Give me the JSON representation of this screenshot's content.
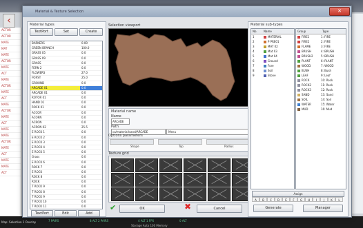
{
  "background": {
    "left_rows": [
      "ACTOR",
      "ACTOR",
      "MATE",
      "MAT",
      "MATE",
      "ACTOR",
      "MATE",
      "ACT",
      "MATE",
      "ACTOR",
      "MATE",
      "ACT",
      "MATE",
      "ACTOR",
      "MATE",
      "ACT",
      "MATE",
      "MATE",
      "ACTOR",
      "MATE",
      "ACT",
      "MATE",
      "MATE",
      "ACT"
    ],
    "status_text": "Map: Selection 1 Overlay",
    "stats": [
      "7 PAIRS",
      "8 ALT 2 PAIRS",
      "4 ALT 1 FPS",
      "0 ALT"
    ],
    "bottom_hint": "Storage  Auto  100  Memory"
  },
  "dialog": {
    "title": "Material & Texture Selection",
    "close_label": "✕"
  },
  "left_panel": {
    "header": "Material types",
    "buttons": [
      "TextPort",
      "Set",
      "Create"
    ],
    "materials": [
      {
        "name": "BARKERS",
        "value": "0.00"
      },
      {
        "name": "GREEN BRANCH",
        "value": "100.0"
      },
      {
        "name": "GRASS 05",
        "value": "0.0"
      },
      {
        "name": "GRASS 09",
        "value": "0.0"
      },
      {
        "name": "GRASS",
        "value": "0.0"
      },
      {
        "name": "FERN 2",
        "value": "0.0"
      },
      {
        "name": "FLOWERS",
        "value": "27.0"
      },
      {
        "name": "FORST",
        "value": "25.0"
      },
      {
        "name": "GROUND",
        "value": "0.0"
      },
      {
        "name": "ARCADE 01",
        "value": "0.0"
      },
      {
        "name": "ARCADE 01",
        "value": "0.0"
      },
      {
        "name": "ROTOR 01",
        "value": "0.0"
      },
      {
        "name": "HAND 01",
        "value": "0.0"
      },
      {
        "name": "ROCK 01",
        "value": "0.0"
      },
      {
        "name": "ACCOR",
        "value": "0.0"
      },
      {
        "name": "ACORN",
        "value": "0.0"
      },
      {
        "name": "ACRON",
        "value": "0.0"
      },
      {
        "name": "ACRON 02",
        "value": "25.5"
      },
      {
        "name": "E ROCK 1",
        "value": "0.0"
      },
      {
        "name": "E ROCK 2",
        "value": "0.0"
      },
      {
        "name": "E ROCK 3",
        "value": "0.0"
      },
      {
        "name": "E ROCK 4",
        "value": "0.0"
      },
      {
        "name": "E ROCK 5",
        "value": "0.0"
      },
      {
        "name": "Grass",
        "value": "0.0"
      },
      {
        "name": "E ROCK 6",
        "value": "0.0"
      },
      {
        "name": "ROCK 7",
        "value": "0.0"
      },
      {
        "name": "E ROCK",
        "value": "0.0"
      },
      {
        "name": "ROCK 8",
        "value": "0.0"
      },
      {
        "name": "ROCK",
        "value": "0.0"
      },
      {
        "name": "T ROCK 9",
        "value": "0.0"
      },
      {
        "name": "T ROCK 8",
        "value": "0.0"
      },
      {
        "name": "T ROCK 9",
        "value": "0.0"
      },
      {
        "name": "T ROCK 10",
        "value": "0.0"
      },
      {
        "name": "T ROCK 11",
        "value": "0.0"
      },
      {
        "name": "T ROCK",
        "value": "0.0"
      }
    ],
    "selected_index": 9,
    "bottom_buttons": [
      "TextPort",
      "Edit",
      "Add"
    ]
  },
  "center": {
    "preview_label": "Selection viewport",
    "properties_label": "Material name",
    "name_label": "Name",
    "name_value": "ARCADE",
    "path_label": "Path",
    "path_value": "ca/material/sand/ARCADE",
    "path_suffix": "Menu",
    "options_label": "Options parameters",
    "option_fields": [
      "Shape",
      "Top",
      "Radius"
    ],
    "edit_label": "Texture grid",
    "ok_label": "OK",
    "cancel_label": "Cancel",
    "ok_icon": "checkmark-icon",
    "cancel_icon": "cross-icon"
  },
  "right_panel": {
    "header": "Material sub-types",
    "left_table": {
      "columns": [
        "No.",
        "Name"
      ],
      "rows": [
        {
          "no": "1",
          "name": "MATERIAL",
          "color": "#d04040"
        },
        {
          "no": "2",
          "name": "P PRE01",
          "color": "#d07030"
        },
        {
          "no": "3",
          "name": "MAT 02",
          "color": "#c0a030"
        },
        {
          "no": "4",
          "name": "Mat 03",
          "color": "#50a040"
        },
        {
          "no": "5",
          "name": "Mat 04",
          "color": "#4070d0"
        },
        {
          "no": "6",
          "name": "Ground",
          "color": "#8050c0"
        },
        {
          "no": "7",
          "name": "Fore",
          "color": "#4080c0"
        },
        {
          "no": "8",
          "name": "Soil",
          "color": "#7090d0"
        },
        {
          "no": "9",
          "name": "Stone",
          "color": "#5060b0"
        }
      ]
    },
    "right_table": {
      "columns": [
        "Group",
        "Type"
      ],
      "rows": [
        {
          "group": "FIRE1",
          "type": "1: FIRE",
          "color": "#d04040"
        },
        {
          "group": "FIRE2",
          "type": "2: FIRE",
          "color": "#d04040"
        },
        {
          "group": "FLAME",
          "type": "3: FIRE",
          "color": "#d07030"
        },
        {
          "group": "BRUSH",
          "type": "4: BRUSH",
          "color": "#c05090"
        },
        {
          "group": "BRUSH2",
          "type": "5: BRUSH",
          "color": "#c05090"
        },
        {
          "group": "PLANT",
          "type": "6: PLANT",
          "color": "#50a040"
        },
        {
          "group": "WOOD",
          "type": "7: WOOD",
          "color": "#a07040"
        },
        {
          "group": "BUSH",
          "type": "8: Bush",
          "color": "#50a040"
        },
        {
          "group": "LEAF",
          "type": "9: Leaf",
          "color": "#50a040"
        },
        {
          "group": "ROCK",
          "type": "10: Rock",
          "color": "#9090a0"
        },
        {
          "group": "ROCK2",
          "type": "11: Rock",
          "color": "#9090a0"
        },
        {
          "group": "ROCK3",
          "type": "12: Rock",
          "color": "#9090a0"
        },
        {
          "group": "SAND",
          "type": "13: Sand",
          "color": "#d0b060"
        },
        {
          "group": "SOIL",
          "type": "14: Soil",
          "color": "#a07040"
        },
        {
          "group": "WATER",
          "type": "15: Water",
          "color": "#4080d0"
        },
        {
          "group": "MUD",
          "type": "16: Mud",
          "color": "#806040"
        }
      ]
    },
    "assign_label": "Assign",
    "letters": [
      "A",
      "B",
      "C",
      "D",
      "E",
      "F",
      "G",
      "H",
      "I",
      "J",
      "K",
      "L"
    ],
    "bottom_buttons": [
      "Generate",
      "Manager"
    ]
  }
}
